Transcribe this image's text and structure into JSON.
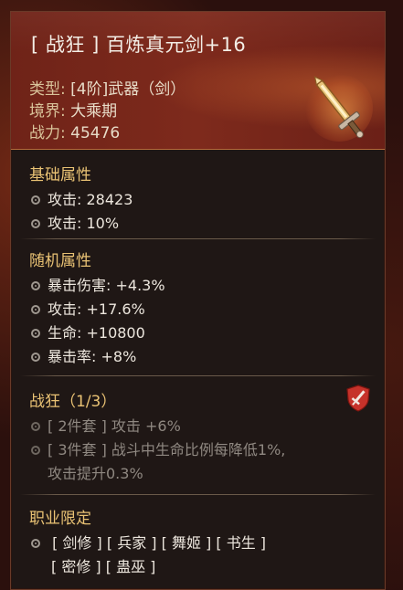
{
  "item": {
    "title_bracket_open": "[",
    "set_name": "战狂",
    "title_bracket_close": "]",
    "name": "百炼真元剑+16",
    "type_label": "类型:",
    "type_value": "[4阶]武器（剑）",
    "realm_label": "境界:",
    "realm_value": "大乘期",
    "power_label": "战力:",
    "power_value": "45476"
  },
  "base_attrs": {
    "title": "基础属性",
    "lines": [
      "攻击: 28423",
      "攻击: 10%"
    ]
  },
  "random_attrs": {
    "title": "随机属性",
    "lines": [
      "暴击伤害: +4.3%",
      "攻击: +17.6%",
      "生命: +10800",
      "暴击率: +8%"
    ]
  },
  "set_bonus": {
    "title": "战狂（1/3）",
    "lines": [
      "[ 2件套 ] 攻击 +6%",
      "[ 3件套 ] 战斗中生命比例每降低1%,",
      "攻击提升0.3%"
    ]
  },
  "class_limit": {
    "title": "职业限定",
    "row1": [
      "[ 剑修 ]",
      "[ 兵家 ]",
      "[ 舞姬 ]",
      "[ 书生 ]"
    ],
    "row2": [
      "[ 密修 ]",
      "[ 蛊巫 ]"
    ]
  },
  "colors": {
    "header_red": "#7e2a1c",
    "section_gold": "#e9c274",
    "dim_text": "#8f8881",
    "shield_red": "#c6322a"
  },
  "icons": {
    "weapon": "sword-icon",
    "set": "shield-sword-icon",
    "bullet": "circle-bullet-icon"
  }
}
